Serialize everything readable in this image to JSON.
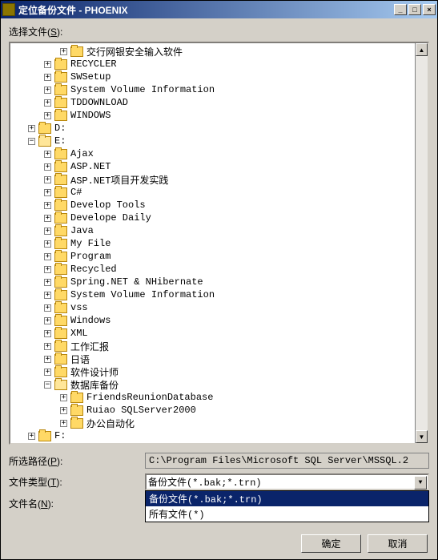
{
  "window_title": "定位备份文件 - PHOENIX",
  "select_files_label": "选择文件",
  "select_files_hotkey": "S",
  "tree": [
    {
      "indent": 60,
      "exp": "plus",
      "open": false,
      "label": "交行网银安全输入软件"
    },
    {
      "indent": 40,
      "exp": "plus",
      "open": false,
      "label": "RECYCLER"
    },
    {
      "indent": 40,
      "exp": "plus",
      "open": false,
      "label": "SWSetup"
    },
    {
      "indent": 40,
      "exp": "plus",
      "open": false,
      "label": "System Volume Information"
    },
    {
      "indent": 40,
      "exp": "plus",
      "open": false,
      "label": "TDDOWNLOAD"
    },
    {
      "indent": 40,
      "exp": "plus",
      "open": false,
      "label": "WINDOWS"
    },
    {
      "indent": 20,
      "exp": "plus",
      "open": false,
      "label": "D:"
    },
    {
      "indent": 20,
      "exp": "minus",
      "open": true,
      "label": "E:"
    },
    {
      "indent": 40,
      "exp": "plus",
      "open": false,
      "label": "Ajax"
    },
    {
      "indent": 40,
      "exp": "plus",
      "open": false,
      "label": "ASP.NET"
    },
    {
      "indent": 40,
      "exp": "plus",
      "open": false,
      "label": "ASP.NET项目开发实践"
    },
    {
      "indent": 40,
      "exp": "plus",
      "open": false,
      "label": "C#"
    },
    {
      "indent": 40,
      "exp": "plus",
      "open": false,
      "label": "Develop Tools"
    },
    {
      "indent": 40,
      "exp": "plus",
      "open": false,
      "label": "Develope Daily"
    },
    {
      "indent": 40,
      "exp": "plus",
      "open": false,
      "label": "Java"
    },
    {
      "indent": 40,
      "exp": "plus",
      "open": false,
      "label": "My File"
    },
    {
      "indent": 40,
      "exp": "plus",
      "open": false,
      "label": "Program"
    },
    {
      "indent": 40,
      "exp": "plus",
      "open": false,
      "label": "Recycled"
    },
    {
      "indent": 40,
      "exp": "plus",
      "open": false,
      "label": "Spring.NET & NHibernate"
    },
    {
      "indent": 40,
      "exp": "plus",
      "open": false,
      "label": "System Volume Information"
    },
    {
      "indent": 40,
      "exp": "plus",
      "open": false,
      "label": "vss"
    },
    {
      "indent": 40,
      "exp": "plus",
      "open": false,
      "label": "Windows"
    },
    {
      "indent": 40,
      "exp": "plus",
      "open": false,
      "label": "XML"
    },
    {
      "indent": 40,
      "exp": "plus",
      "open": false,
      "label": "工作汇报"
    },
    {
      "indent": 40,
      "exp": "plus",
      "open": false,
      "label": "日语"
    },
    {
      "indent": 40,
      "exp": "plus",
      "open": false,
      "label": "软件设计师"
    },
    {
      "indent": 40,
      "exp": "minus",
      "open": true,
      "label": "数据库备份"
    },
    {
      "indent": 60,
      "exp": "plus",
      "open": false,
      "label": "FriendsReunionDatabase"
    },
    {
      "indent": 60,
      "exp": "plus",
      "open": false,
      "label": "Ruiao SQLServer2000"
    },
    {
      "indent": 60,
      "exp": "plus",
      "open": false,
      "label": "办公自动化"
    },
    {
      "indent": 20,
      "exp": "plus",
      "open": false,
      "label": "F:"
    }
  ],
  "selected_path_label": "所选路径",
  "selected_path_hotkey": "P",
  "selected_path_value": "C:\\Program Files\\Microsoft SQL Server\\MSSQL.2",
  "file_type_label": "文件类型",
  "file_type_hotkey": "T",
  "file_type_value": "备份文件(*.bak;*.trn)",
  "file_type_options": [
    "备份文件(*.bak;*.trn)",
    "所有文件(*)"
  ],
  "file_name_label": "文件名",
  "file_name_hotkey": "N",
  "file_name_value": "",
  "ok_label": "确定",
  "cancel_label": "取消"
}
